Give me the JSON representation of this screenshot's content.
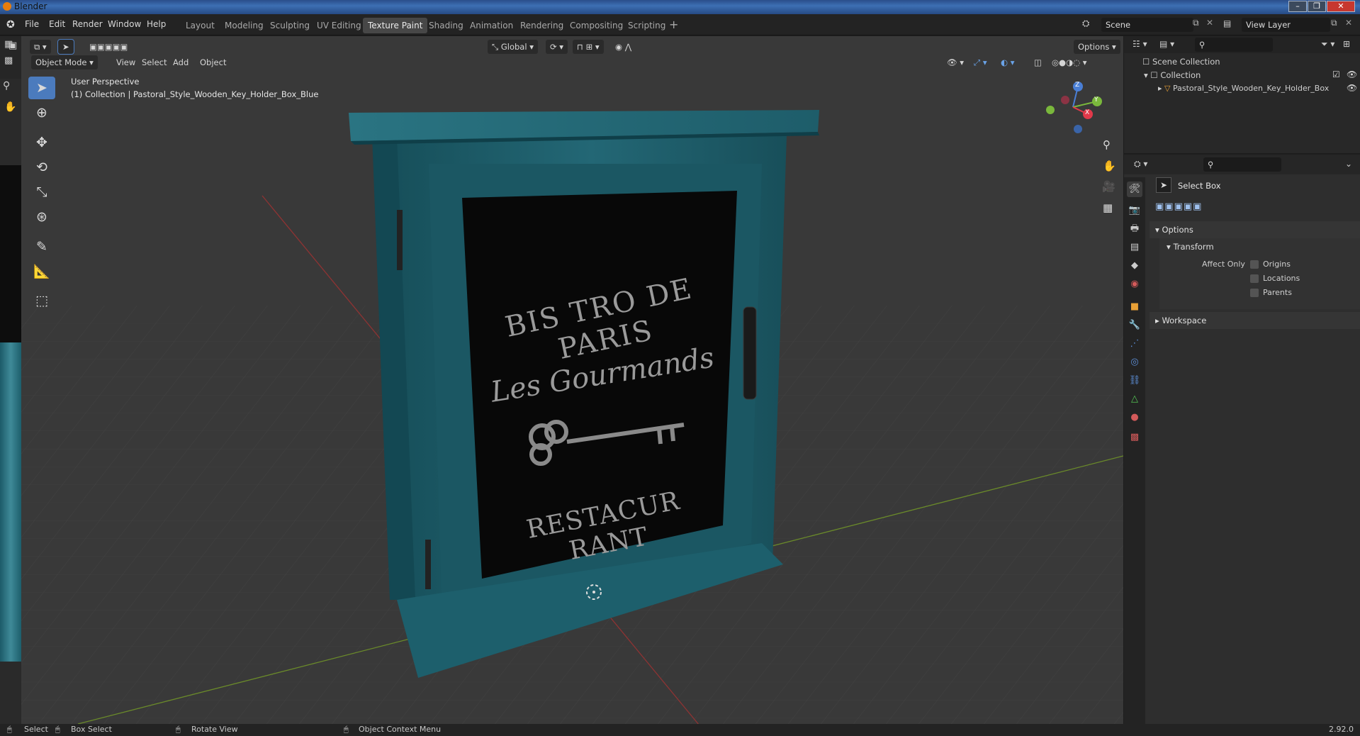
{
  "window": {
    "title": "Blender"
  },
  "menu": [
    "File",
    "Edit",
    "Render",
    "Window",
    "Help"
  ],
  "workspaces": [
    "Layout",
    "Modeling",
    "Sculpting",
    "UV Editing",
    "Texture Paint",
    "Shading",
    "Animation",
    "Rendering",
    "Compositing",
    "Scripting"
  ],
  "active_workspace": "Texture Paint",
  "scene": {
    "name": "Scene",
    "view_layer": "View Layer"
  },
  "viewport": {
    "mode": "Object Mode",
    "header_menus": [
      "View",
      "Select",
      "Add",
      "Object"
    ],
    "orientation": "Global",
    "options_label": "Options",
    "info_line1": "User Perspective",
    "info_line2": "(1) Collection | Pastoral_Style_Wooden_Key_Holder_Box_Blue"
  },
  "model": {
    "sign_line1": "BIS TRO DE PARIS",
    "sign_line2": "Les Gourmands",
    "sign_line3": "RESTACUR RANT",
    "colors": {
      "wood": "#1f5a66",
      "wood_dark": "#16444d",
      "board": "#080808",
      "engraving": "#8a8a8a"
    }
  },
  "gizmo": {
    "z": "Z",
    "y": "Y",
    "x": "X"
  },
  "outliner": {
    "root": "Scene Collection",
    "collection": "Collection",
    "object": "Pastoral_Style_Wooden_Key_Holder_Box"
  },
  "properties": {
    "tool_name": "Select Box",
    "panel_options": "Options",
    "subpanel_transform": "Transform",
    "affect_only_label": "Affect Only",
    "checkboxes": [
      "Origins",
      "Locations",
      "Parents"
    ],
    "panel_workspace": "Workspace"
  },
  "statusbar": {
    "select": "Select",
    "box_select": "Box Select",
    "rotate_view": "Rotate View",
    "context_menu": "Object Context Menu",
    "version": "2.92.0"
  },
  "icons": {
    "blender_logo": "blender-icon",
    "tools": [
      "select-box-icon",
      "cursor-icon",
      "move-icon",
      "rotate-icon",
      "scale-icon",
      "transform-icon",
      "annotate-icon",
      "measure-icon",
      "add-cube-icon"
    ],
    "nav": [
      "zoom-icon",
      "hand-icon",
      "camera-icon",
      "grid-icon"
    ]
  },
  "accent": "#4b7bbd"
}
